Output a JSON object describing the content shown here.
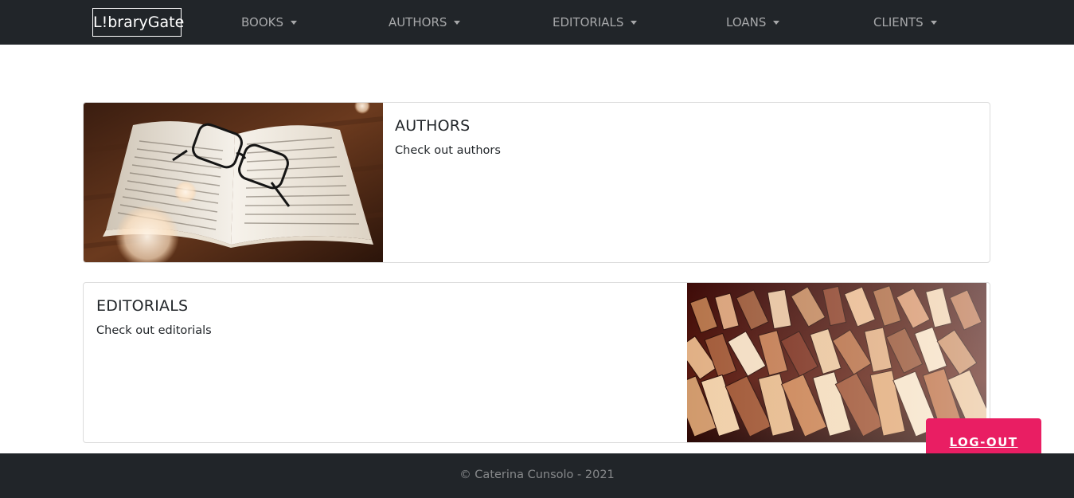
{
  "navbar": {
    "brand": "L!braryGate",
    "items": [
      {
        "label": "BOOKS"
      },
      {
        "label": "AUTHORS"
      },
      {
        "label": "EDITORIALS"
      },
      {
        "label": "LOANS"
      },
      {
        "label": "CLIENTS"
      }
    ]
  },
  "cards": [
    {
      "title": "AUTHORS",
      "text": "Check out authors",
      "image": "open-book-glasses-photo"
    },
    {
      "title": "EDITORIALS",
      "text": "Check out editorials",
      "image": "stacked-books-photo"
    }
  ],
  "logout": {
    "label": "LOG-OUT"
  },
  "footer": {
    "text": "© Caterina Cunsolo - 2021"
  },
  "colors": {
    "navbar_bg": "#212529",
    "logout_bg": "#e91e63",
    "card_border": "#dcdcdc"
  }
}
